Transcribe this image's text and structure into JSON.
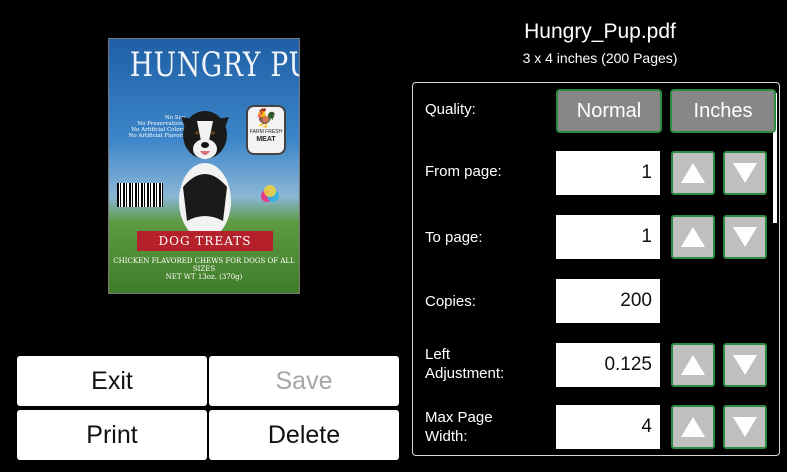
{
  "file": {
    "name": "Hungry_Pup.pdf",
    "info": "3 x 4 inches (200 Pages)"
  },
  "preview": {
    "brand": "HUNGRY PUP",
    "notes": [
      "No Soy",
      "No Preservatives",
      "No Artificial Colors",
      "No Artificial Flavors"
    ],
    "badge_line1": "FARM FRESH",
    "badge_line2": "MEAT",
    "ribbon": "DOG TREATS",
    "bottom_line1": "CHICKEN FLAVORED CHEWS FOR DOGS OF ALL SIZES",
    "bottom_line2": "NET WT 13oz. (370g)"
  },
  "settings": {
    "quality_label": "Quality:",
    "quality_value": "Normal",
    "units_value": "Inches",
    "from_page_label": "From page:",
    "from_page_value": "1",
    "to_page_label": "To page:",
    "to_page_value": "1",
    "copies_label": "Copies:",
    "copies_value": "200",
    "left_adjustment_label_1": "Left",
    "left_adjustment_label_2": "Adjustment:",
    "left_adjustment_value": "0.125",
    "max_page_width_label_1": "Max Page",
    "max_page_width_label_2": "Width:",
    "max_page_width_value": "4"
  },
  "actions": {
    "exit": "Exit",
    "save": "Save",
    "print": "Print",
    "delete": "Delete"
  },
  "colors": {
    "accent_border": "#2e8a3e",
    "arrow_fill": "#bfbfbf",
    "pill_fill": "#878787",
    "ribbon": "#b5212b"
  }
}
